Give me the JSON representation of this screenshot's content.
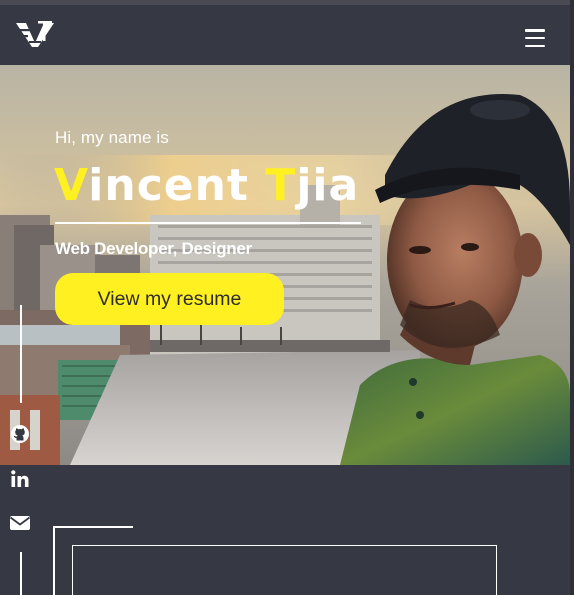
{
  "nav": {
    "logo_icon": "vt-monogram-logo",
    "menu_icon": "hamburger-menu-icon"
  },
  "hero": {
    "greeting": "Hi, my name is",
    "name": {
      "first_initial": "V",
      "first_rest": "incent ",
      "last_initial": "T",
      "last_rest": "jia"
    },
    "subtitle": "Web Developer, Designer",
    "resume_button": "View my resume",
    "photo": "portrait-photo-rooftop-city"
  },
  "social": [
    {
      "icon": "github-icon"
    },
    {
      "icon": "linkedin-icon"
    },
    {
      "icon": "envelope-icon"
    }
  ],
  "colors": {
    "background": "#363843",
    "accent": "#fff021",
    "text": "#ffffff"
  }
}
